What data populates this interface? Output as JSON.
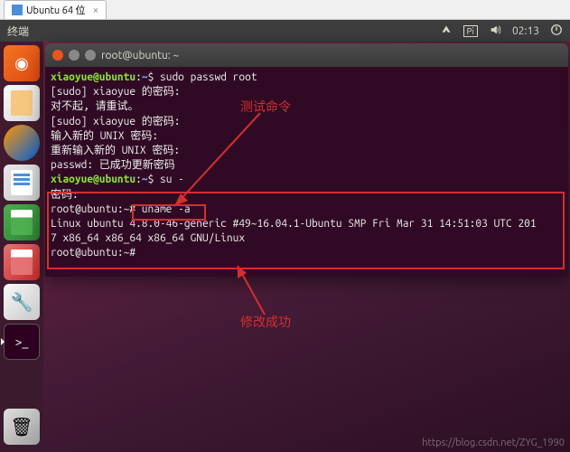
{
  "vm_tab": {
    "label": "Ubuntu 64 位",
    "close": "×"
  },
  "top_panel": {
    "title": "终端",
    "time": "02:13",
    "lang": "Pi"
  },
  "launcher": {
    "items": [
      {
        "name": "ubuntu-dash",
        "glyph": "◉"
      },
      {
        "name": "files"
      },
      {
        "name": "firefox"
      },
      {
        "name": "libreoffice-writer"
      },
      {
        "name": "libreoffice-calc"
      },
      {
        "name": "libreoffice-impress"
      },
      {
        "name": "system-settings",
        "glyph": "🔧"
      },
      {
        "name": "terminal",
        "glyph": ">_"
      },
      {
        "name": "trash",
        "glyph": "🗑"
      }
    ]
  },
  "terminal": {
    "title": "root@ubuntu: ~",
    "prompt_user": "xiaoyue@ubuntu",
    "prompt_sep": ":",
    "prompt_path": "~",
    "prompt_end": "$",
    "lines": {
      "l1_cmd": " sudo passwd root",
      "l2": "[sudo] xiaoyue 的密码:",
      "l3": "对不起, 请重试。",
      "l4": "[sudo] xiaoyue 的密码:",
      "l5": "输入新的 UNIX 密码:",
      "l6": "重新输入新的 UNIX 密码:",
      "l7": "passwd: 已成功更新密码",
      "l8_cmd": " su -",
      "l9": "密码:",
      "l10": "root@ubuntu:~# uname -a",
      "l11": "Linux ubuntu 4.8.0-46-generic #49~16.04.1-Ubuntu SMP Fri Mar 31 14:51:03 UTC 201",
      "l12": "7 x86_64 x86_64 x86_64 GNU/Linux",
      "l13": "root@ubuntu:~#"
    }
  },
  "annotations": {
    "test_cmd": "测试命令",
    "success": "修改成功"
  },
  "watermark": "https://blog.csdn.net/ZYG_1990"
}
